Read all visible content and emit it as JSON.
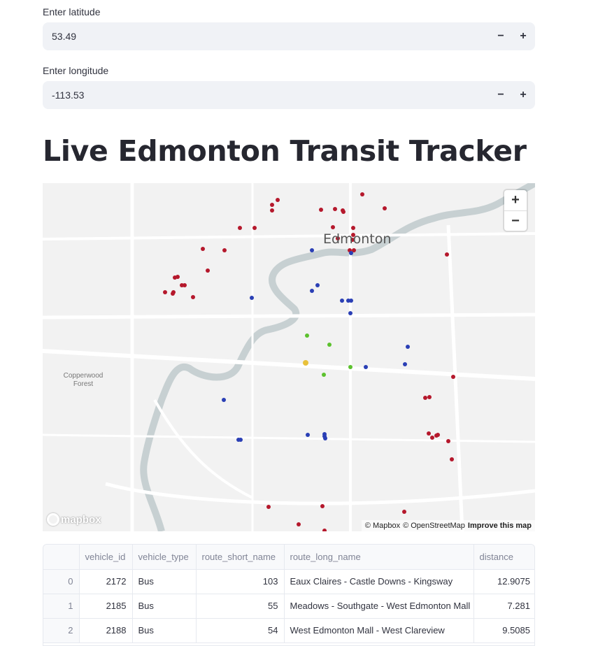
{
  "inputs": {
    "latitude": {
      "label": "Enter latitude",
      "value": "53.49"
    },
    "longitude": {
      "label": "Enter longitude",
      "value": "-113.53"
    },
    "minus": "−",
    "plus": "+"
  },
  "title": "Live Edmonton Transit Tracker",
  "map": {
    "city_label": "Edmonton",
    "forest_label": "Copperwood Forest",
    "zoom_in": "+",
    "zoom_out": "−",
    "logo": "mapbox",
    "attribution": [
      "© Mapbox",
      "© OpenStreetMap",
      "Improve this map"
    ],
    "marker_colors": {
      "red": "#b5182c",
      "blue": "#2a3fb5",
      "green": "#5cc12e",
      "yellow": "#e8c13a"
    }
  },
  "table": {
    "columns": [
      "",
      "vehicle_id",
      "vehicle_type",
      "route_short_name",
      "route_long_name",
      "distance"
    ],
    "rows": [
      [
        "0",
        "2172",
        "Bus",
        "103",
        "Eaux Claires - Castle Downs - Kingsway",
        "12.9075"
      ],
      [
        "1",
        "2185",
        "Bus",
        "55",
        "Meadows - Southgate - West Edmonton Mall",
        "7.281"
      ],
      [
        "2",
        "2188",
        "Bus",
        "54",
        "West Edmonton Mall - West Clareview",
        "9.5085"
      ]
    ]
  }
}
